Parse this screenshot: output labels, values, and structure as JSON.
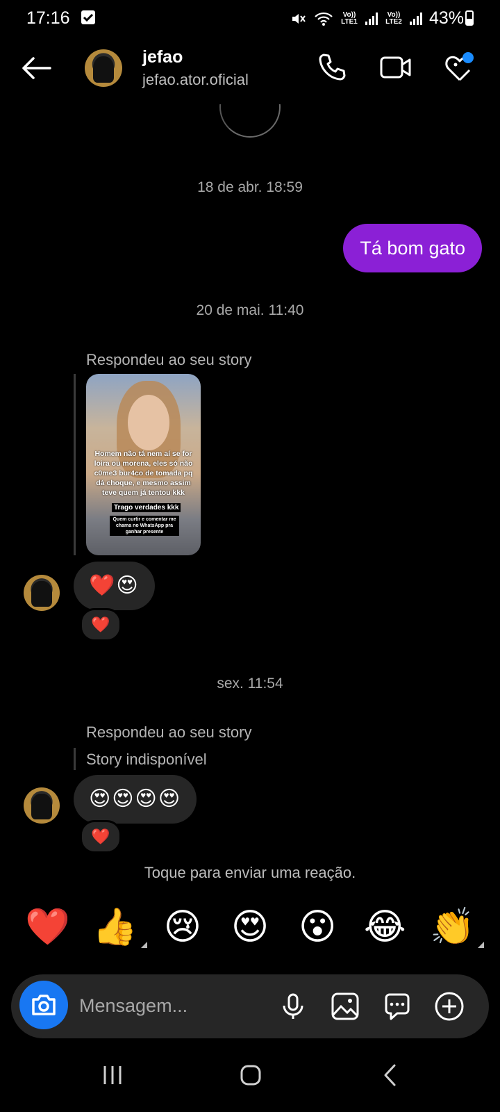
{
  "status_bar": {
    "time": "17:16",
    "sim1": "Vo)) LTE1",
    "sim2": "Vo)) LTE2",
    "battery": "43%"
  },
  "header": {
    "name": "jefao",
    "username": "jefao.ator.oficial",
    "icons": [
      "back-arrow-icon",
      "phone-icon",
      "video-camera-icon",
      "heart-icon"
    ]
  },
  "thread": {
    "timestamp_1": "18 de abr. 18:59",
    "outgoing_1": "Tá bom gato",
    "timestamp_2": "20 de mai. 11:40",
    "reply_label_1": "Respondeu ao seu story",
    "story": {
      "caption": "Homem não tá nem aí se for loira ou morena, eles só não c0me3 bur4co de tomada pq dá choque, e mesmo assim teve quem já tentou kkk",
      "tag": "Trago verdades kkk",
      "small": "Quem curtir e comentar me chama no WhatsApp pra ganhar presente"
    },
    "incoming_1": "❤️😍",
    "reaction_1": "❤️",
    "timestamp_3": "sex. 11:54",
    "reply_label_2": "Respondeu ao seu story",
    "story_unavailable": "Story indisponível",
    "incoming_2": "😍😍😍😍",
    "reaction_2": "❤️"
  },
  "reactions": {
    "hint": "Toque para enviar uma reação.",
    "emojis": [
      "❤️",
      "👍",
      "😢",
      "😍",
      "😮",
      "😂",
      "👏"
    ]
  },
  "composer": {
    "placeholder": "Mensagem..."
  },
  "colors": {
    "background": "#000000",
    "outgoing_bubble": "#8b20d6",
    "incoming_bubble": "#262626",
    "camera_button": "#1877f2",
    "notification_dot": "#1a8cff"
  }
}
